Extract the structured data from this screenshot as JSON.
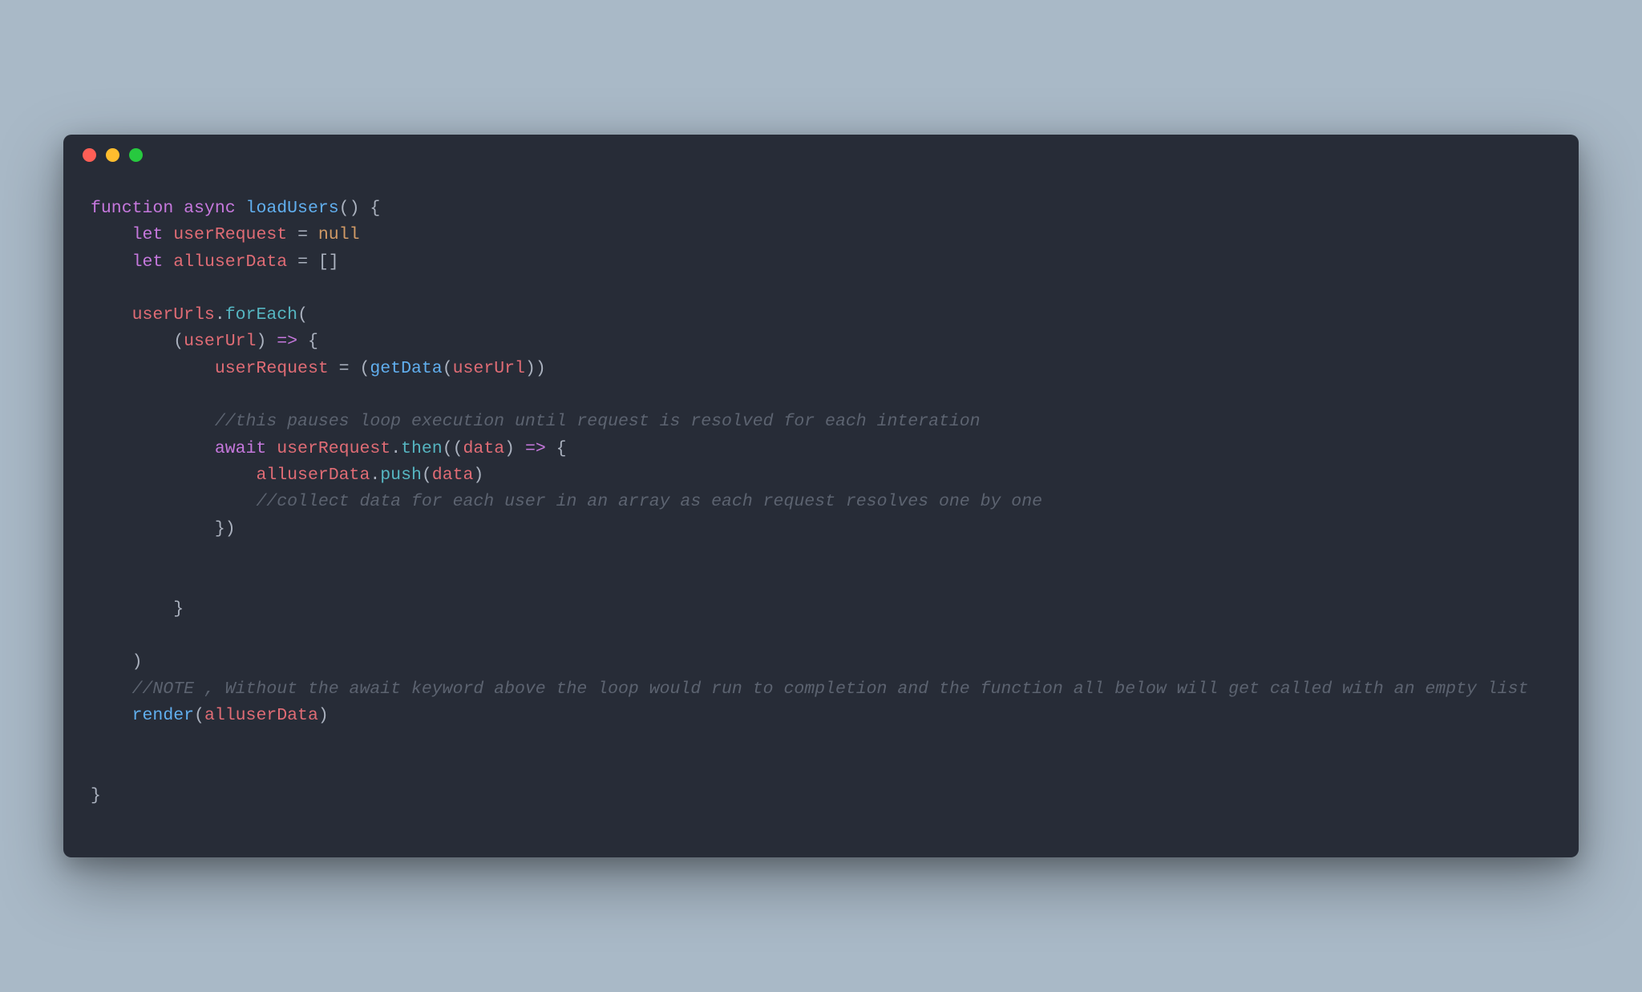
{
  "window": {
    "traffic_lights": [
      "red",
      "yellow",
      "green"
    ]
  },
  "code": {
    "tokens": [
      [
        {
          "c": "kw",
          "t": "function"
        },
        {
          "c": "pun",
          "t": " "
        },
        {
          "c": "kw",
          "t": "async"
        },
        {
          "c": "pun",
          "t": " "
        },
        {
          "c": "fn",
          "t": "loadUsers"
        },
        {
          "c": "pun",
          "t": "() {"
        }
      ],
      [
        {
          "c": "pun",
          "t": "    "
        },
        {
          "c": "kw",
          "t": "let"
        },
        {
          "c": "pun",
          "t": " "
        },
        {
          "c": "var",
          "t": "userRequest"
        },
        {
          "c": "pun",
          "t": " = "
        },
        {
          "c": "num",
          "t": "null"
        }
      ],
      [
        {
          "c": "pun",
          "t": "    "
        },
        {
          "c": "kw",
          "t": "let"
        },
        {
          "c": "pun",
          "t": " "
        },
        {
          "c": "var",
          "t": "alluserData"
        },
        {
          "c": "pun",
          "t": " = []"
        }
      ],
      [],
      [
        {
          "c": "pun",
          "t": "    "
        },
        {
          "c": "var",
          "t": "userUrls"
        },
        {
          "c": "pun",
          "t": "."
        },
        {
          "c": "call",
          "t": "forEach"
        },
        {
          "c": "pun",
          "t": "("
        }
      ],
      [
        {
          "c": "pun",
          "t": "        ("
        },
        {
          "c": "var",
          "t": "userUrl"
        },
        {
          "c": "pun",
          "t": ") "
        },
        {
          "c": "kw",
          "t": "=>"
        },
        {
          "c": "pun",
          "t": " {"
        }
      ],
      [
        {
          "c": "pun",
          "t": "            "
        },
        {
          "c": "var",
          "t": "userRequest"
        },
        {
          "c": "pun",
          "t": " = ("
        },
        {
          "c": "fn",
          "t": "getData"
        },
        {
          "c": "pun",
          "t": "("
        },
        {
          "c": "var",
          "t": "userUrl"
        },
        {
          "c": "pun",
          "t": "))"
        }
      ],
      [],
      [
        {
          "c": "pun",
          "t": "            "
        },
        {
          "c": "cm",
          "t": "//this pauses loop execution until request is resolved for each interation"
        }
      ],
      [
        {
          "c": "pun",
          "t": "            "
        },
        {
          "c": "kw",
          "t": "await"
        },
        {
          "c": "pun",
          "t": " "
        },
        {
          "c": "var",
          "t": "userRequest"
        },
        {
          "c": "pun",
          "t": "."
        },
        {
          "c": "call",
          "t": "then"
        },
        {
          "c": "pun",
          "t": "(("
        },
        {
          "c": "var",
          "t": "data"
        },
        {
          "c": "pun",
          "t": ") "
        },
        {
          "c": "kw",
          "t": "=>"
        },
        {
          "c": "pun",
          "t": " {"
        }
      ],
      [
        {
          "c": "pun",
          "t": "                "
        },
        {
          "c": "var",
          "t": "alluserData"
        },
        {
          "c": "pun",
          "t": "."
        },
        {
          "c": "call",
          "t": "push"
        },
        {
          "c": "pun",
          "t": "("
        },
        {
          "c": "var",
          "t": "data"
        },
        {
          "c": "pun",
          "t": ")"
        }
      ],
      [
        {
          "c": "pun",
          "t": "                "
        },
        {
          "c": "cm",
          "t": "//collect data for each user in an array as each request resolves one by one"
        }
      ],
      [
        {
          "c": "pun",
          "t": "            })"
        }
      ],
      [],
      [],
      [
        {
          "c": "pun",
          "t": "        }"
        }
      ],
      [],
      [
        {
          "c": "pun",
          "t": "    )"
        }
      ],
      [
        {
          "c": "pun",
          "t": "    "
        },
        {
          "c": "cm",
          "t": "//NOTE , Without the await keyword above the loop would run to completion and the function all below will get called with an empty list"
        }
      ],
      [
        {
          "c": "pun",
          "t": "    "
        },
        {
          "c": "fn",
          "t": "render"
        },
        {
          "c": "pun",
          "t": "("
        },
        {
          "c": "var",
          "t": "alluserData"
        },
        {
          "c": "pun",
          "t": ")"
        }
      ],
      [],
      [],
      [
        {
          "c": "pun",
          "t": "}"
        }
      ]
    ]
  }
}
